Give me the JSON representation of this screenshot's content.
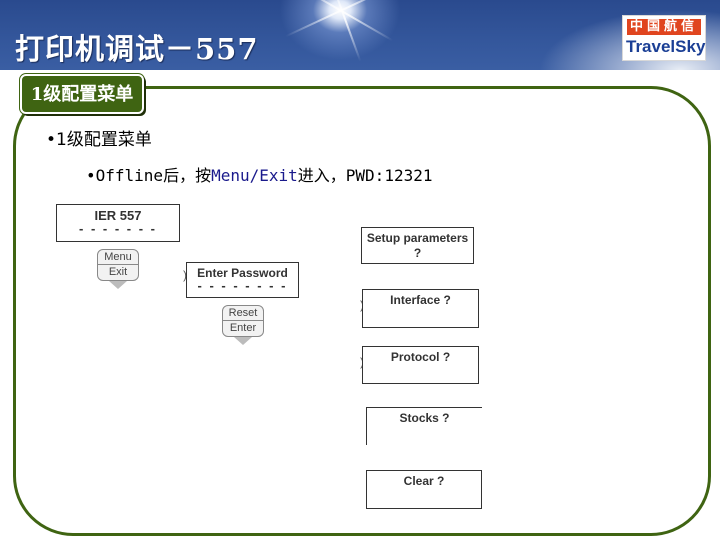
{
  "header": {
    "title": "打印机调试－557",
    "logo_cn": "中国航信",
    "logo_en": "TravelSky"
  },
  "section_tab": "1级配置菜单",
  "bullets": {
    "level1": "•1级配置菜单",
    "level2_prefix": "•Offline后，按",
    "level2_key": "Menu/Exit",
    "level2_suffix": "进入，PWD:12321"
  },
  "diagram": {
    "display_main": {
      "line1": "IER 557",
      "line2": "- - - - - - -"
    },
    "button_menu_exit": {
      "top": "Menu",
      "bottom": "Exit"
    },
    "display_password": {
      "line1": "Enter Password",
      "line2": "- - - - - - - -"
    },
    "button_reset_enter": {
      "top": "Reset",
      "bottom": "Enter"
    },
    "menu_items": [
      {
        "label": "Setup parameters ?"
      },
      {
        "label": "Interface ?"
      },
      {
        "label": "Protocol ?"
      },
      {
        "label": "Stocks ?"
      },
      {
        "label": "Clear ?"
      }
    ]
  },
  "colors": {
    "header_blue": "#2a4a8e",
    "frame_green": "#3f6412",
    "logo_red": "#e0451f",
    "logo_blue": "#1b3f95",
    "key_text_blue": "#1a1a8c"
  }
}
